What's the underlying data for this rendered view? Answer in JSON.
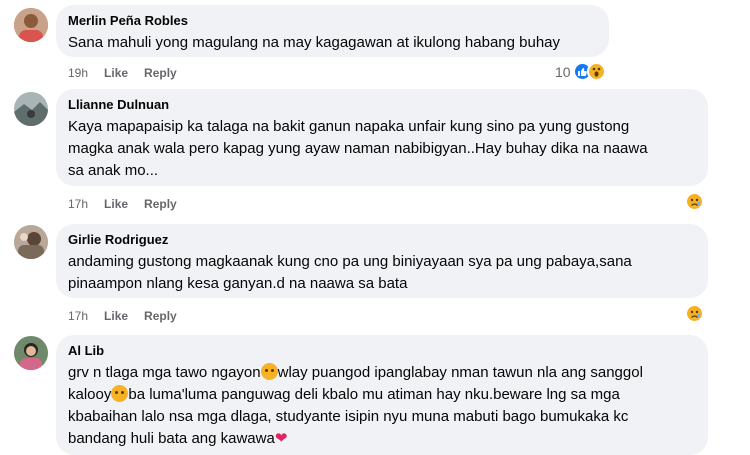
{
  "comments": [
    {
      "author": "Merlin Peña Robles",
      "text": "Sana mahuli yong magulang na may kagagawan at ikulong habang buhay",
      "time": "19h",
      "like": "Like",
      "reply": "Reply",
      "reaction_count": "10",
      "reactions": [
        "like-icon",
        "wow-icon"
      ],
      "avatar_color": "#d9534f"
    },
    {
      "author": "Llianne Dulnuan",
      "text": "Kaya mapapaisip ka talaga na bakit ganun napaka unfair kung sino pa yung gustong\nmagka anak wala pero kapag yung ayaw naman nabibigyan..Hay buhay dika na naawa\nsa anak mo...",
      "time": "17h",
      "like": "Like",
      "reply": "Reply",
      "reactions": [
        "sad-icon"
      ],
      "avatar_color": "#7a8a8c"
    },
    {
      "author": "Girlie Rodriguez",
      "text": "andaming gustong magkaanak kung cno pa ung biniyayaan sya pa ung pabaya,sana\npinaampon nlang kesa ganyan.d na naawa sa bata",
      "time": "17h",
      "like": "Like",
      "reply": "Reply",
      "reactions": [
        "sad-icon"
      ],
      "avatar_color": "#9a7d6b"
    },
    {
      "author": "Al Lib",
      "text_parts": [
        "grv n tlaga mga tawo ngayon",
        "wlay puangod ipanglabay nman tawun nla ang sanggol\nkalooy",
        "ba luma'luma panguwag deli kbalo mu atiman hay nku.beware lng sa mga\nkbabaihan lalo nsa mga dlaga, studyante isipin nyu muna mabuti bago bumukaka kc\nbandang huli bata ang kawawa"
      ],
      "avatar_color": "#3d5a3a"
    }
  ]
}
